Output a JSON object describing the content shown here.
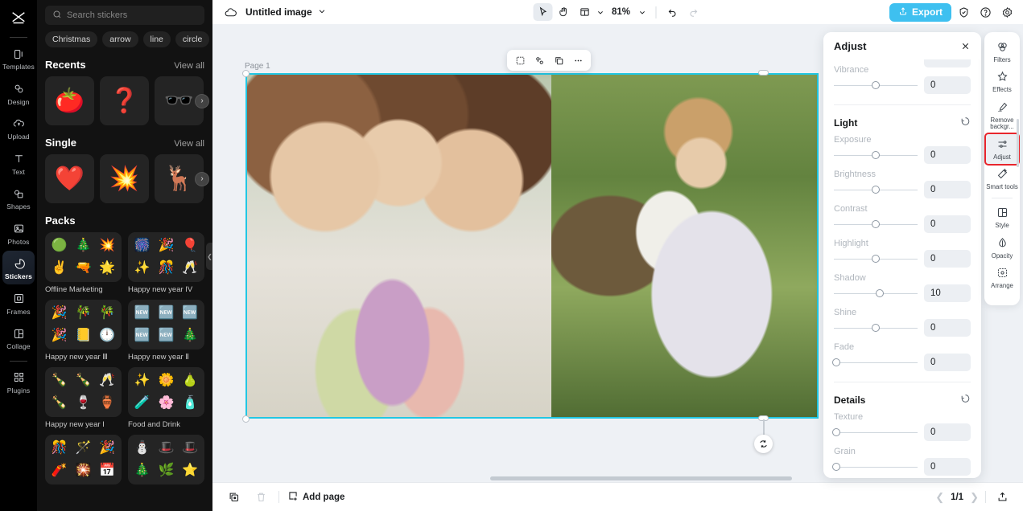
{
  "rail": {
    "logo_icon": "capcut-logo-icon",
    "items": [
      {
        "label": "Templates",
        "icon": "templates-icon"
      },
      {
        "label": "Design",
        "icon": "design-icon"
      },
      {
        "label": "Upload",
        "icon": "upload-icon"
      },
      {
        "label": "Text",
        "icon": "text-icon"
      },
      {
        "label": "Shapes",
        "icon": "shapes-icon"
      },
      {
        "label": "Photos",
        "icon": "photos-icon"
      },
      {
        "label": "Stickers",
        "icon": "stickers-icon",
        "active": true
      },
      {
        "label": "Frames",
        "icon": "frames-icon"
      },
      {
        "label": "Collage",
        "icon": "collage-icon"
      },
      {
        "label": "Plugins",
        "icon": "plugins-icon"
      }
    ]
  },
  "panel": {
    "search": {
      "placeholder": "Search stickers",
      "value": "",
      "icon": "search-icon"
    },
    "tags": [
      "Christmas",
      "arrow",
      "line",
      "circle"
    ],
    "sections": [
      {
        "title": "Recents",
        "view_all": "View all",
        "items": [
          "🍅",
          "❓",
          "🕶️"
        ]
      },
      {
        "title": "Single",
        "view_all": "View all",
        "items": [
          "❤️",
          "💥",
          "🦌"
        ]
      }
    ],
    "packs_title": "Packs",
    "packs": [
      {
        "name": "Offline Marketing",
        "glyphs": [
          "🟢",
          "🎄",
          "💥",
          "✌️",
          "🔫",
          "🌟"
        ]
      },
      {
        "name": "Happy new year IV",
        "glyphs": [
          "🎆",
          "🎉",
          "🎈",
          "✨",
          "🎊",
          "🥂"
        ]
      },
      {
        "name": "Happy new year Ⅲ",
        "glyphs": [
          "🎉",
          "🎋",
          "🎋",
          "🎉",
          "📒",
          "🕛"
        ]
      },
      {
        "name": "Happy new year Ⅱ",
        "glyphs": [
          "🆕",
          "🆕",
          "🆕",
          "🆕",
          "🆕",
          "🎄"
        ]
      },
      {
        "name": "Happy new year I",
        "glyphs": [
          "🍾",
          "🍾",
          "🥂",
          "🍾",
          "🍷",
          "🏺"
        ]
      },
      {
        "name": "Food and Drink",
        "glyphs": [
          "✨",
          "🌼",
          "🍐",
          "🧪",
          "🌸",
          "🧴"
        ]
      },
      {
        "name": "",
        "glyphs": [
          "🎊",
          "🪄",
          "🎉",
          "🧨",
          "🎇",
          "📅"
        ]
      },
      {
        "name": "",
        "glyphs": [
          "⛄",
          "🎩",
          "🎩",
          "🎄",
          "🌿",
          "⭐"
        ]
      }
    ],
    "collapse_icon": "chevron-left-icon"
  },
  "topbar": {
    "cloud_icon": "cloud-sync-icon",
    "title": "Untitled image",
    "title_caret_icon": "chevron-down-icon",
    "tools": [
      {
        "name": "select-tool",
        "icon": "cursor-arrow-icon",
        "selected": true
      },
      {
        "name": "hand-tool",
        "icon": "hand-icon",
        "selected": false
      },
      {
        "name": "layout-tool",
        "icon": "layout-grid-icon",
        "selected": false
      }
    ],
    "layout_caret_icon": "chevron-down-icon",
    "zoom": "81%",
    "zoom_caret_icon": "chevron-down-icon",
    "undo_icon": "undo-icon",
    "redo_icon": "redo-icon",
    "export_label": "Export",
    "export_icon": "upload-box-icon",
    "export_color": "#3ec0f0",
    "right_icons": [
      {
        "name": "shield-check-icon"
      },
      {
        "name": "help-circle-icon"
      },
      {
        "name": "settings-gear-icon"
      }
    ]
  },
  "canvas": {
    "page_label": "Page 1",
    "selection_color": "#21c7e3",
    "rotate_icon": "rotate-icon",
    "float_toolbar": [
      {
        "name": "crop-icon"
      },
      {
        "name": "cutout-icon"
      },
      {
        "name": "duplicate-icon"
      },
      {
        "name": "more-options-icon"
      }
    ]
  },
  "bottombar": {
    "duplicate_page_icon": "duplicate-page-icon",
    "delete_page_icon": "trash-icon",
    "add_page_label": "Add page",
    "add_page_icon": "add-page-icon",
    "prev_icon": "chevron-left-icon",
    "page_indicator": "1/1",
    "next_icon": "chevron-right-icon",
    "export_image_icon": "export-image-icon"
  },
  "adjust": {
    "title": "Adjust",
    "close_icon": "close-icon",
    "reset_icon": "reset-icon",
    "clipped_top_control": {
      "label": "",
      "value": ""
    },
    "groups": [
      {
        "title": "",
        "controls": [
          {
            "label": "Vibrance",
            "value": "0",
            "pos": 50
          }
        ]
      },
      {
        "title": "Light",
        "controls": [
          {
            "label": "Exposure",
            "value": "0",
            "pos": 50
          },
          {
            "label": "Brightness",
            "value": "0",
            "pos": 50
          },
          {
            "label": "Contrast",
            "value": "0",
            "pos": 50
          },
          {
            "label": "Highlight",
            "value": "0",
            "pos": 50
          },
          {
            "label": "Shadow",
            "value": "10",
            "pos": 55
          },
          {
            "label": "Shine",
            "value": "0",
            "pos": 50
          },
          {
            "label": "Fade",
            "value": "0",
            "pos": 0
          }
        ]
      },
      {
        "title": "Details",
        "controls": [
          {
            "label": "Texture",
            "value": "0",
            "pos": 0
          },
          {
            "label": "Grain",
            "value": "0",
            "pos": 0
          }
        ]
      }
    ]
  },
  "toolrail": {
    "items": [
      {
        "label": "Filters",
        "icon": "filters-icon"
      },
      {
        "label": "Effects",
        "icon": "effects-icon"
      },
      {
        "label": "Remove backgr...",
        "icon": "remove-background-icon"
      },
      {
        "label": "Adjust",
        "icon": "adjust-sliders-icon",
        "active": true,
        "highlighted": true
      },
      {
        "label": "Smart tools",
        "icon": "smart-tools-icon"
      },
      {
        "label": "Style",
        "icon": "style-icon"
      },
      {
        "label": "Opacity",
        "icon": "opacity-icon"
      },
      {
        "label": "Arrange",
        "icon": "arrange-icon"
      }
    ],
    "highlight_color": "#e8262d"
  }
}
